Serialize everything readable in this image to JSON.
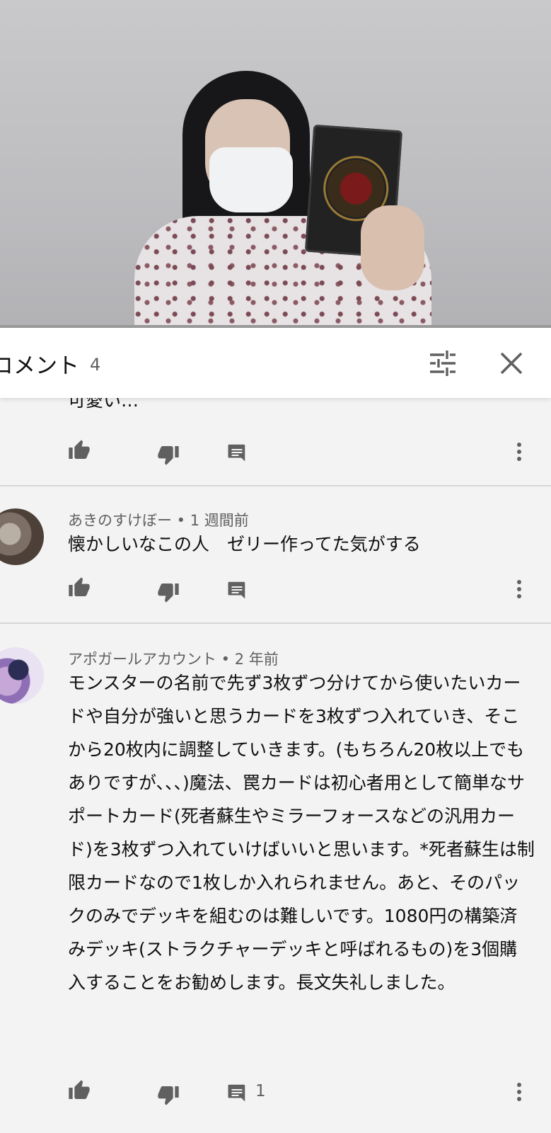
{
  "header": {
    "title": "コメント",
    "count": "4"
  },
  "comments": [
    {
      "text": "可愛い…"
    },
    {
      "author": "あきのすけぼー",
      "time": "1 週間前",
      "text": "懐かしいなこの人　ゼリー作ってた気がする"
    },
    {
      "author": "アポガールアカウント",
      "time": "2 年前",
      "text": "モンスターの名前で先ず3枚ずつ分けてから使いたいカードや自分が強いと思うカードを3枚ずつ入れていき、そこから20枚内に調整していきます。(もちろん20枚以上でもありですが、、、)魔法、罠カードは初心者用として簡単なサポートカード(死者蘇生やミラーフォースなどの汎用カード)を3枚ずつ入れていけばいいと思います。*死者蘇生は制限カードなので1枚しか入れられません。あと、そのパックのみでデッキを組むのは難しいです。1080円の構築済みデッキ(ストラクチャーデッキと呼ばれるもの)を3個購入することをお勧めします。長文失礼しました。",
      "reply_count": "1"
    }
  ],
  "meta_sep": " • ",
  "icons": {
    "like": "thumb-up-icon",
    "dislike": "thumb-down-icon",
    "reply": "reply-icon",
    "more": "more-vert-icon",
    "sort": "sort-icon",
    "close": "close-icon"
  }
}
